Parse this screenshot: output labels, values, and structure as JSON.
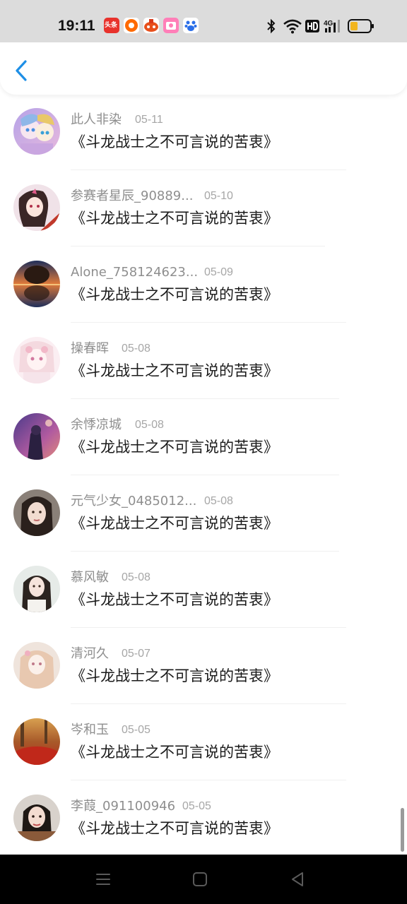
{
  "status_bar": {
    "time": "19:11",
    "notification_icons": [
      "toutiao-icon",
      "taobao-icon",
      "game-icon",
      "album-icon",
      "baidu-icon"
    ],
    "system_icons": [
      "bluetooth-icon",
      "wifi-icon",
      "hd-icon",
      "signal-4g-icon",
      "battery-icon"
    ],
    "toutiao_label": "头条"
  },
  "header": {
    "back_icon": "chevron-left-icon"
  },
  "list": {
    "items": [
      {
        "name": "此人非染",
        "date": "05-11",
        "title": "《斗龙战士之不可言说的苦衷》"
      },
      {
        "name": "参赛者星辰_90889...",
        "date": "05-10",
        "title": "《斗龙战士之不可言说的苦衷》"
      },
      {
        "name": "Alone_758124623...",
        "date": "05-09",
        "title": "《斗龙战士之不可言说的苦衷》"
      },
      {
        "name": "操春晖",
        "date": "05-08",
        "title": "《斗龙战士之不可言说的苦衷》"
      },
      {
        "name": "余悸凉城",
        "date": "05-08",
        "title": "《斗龙战士之不可言说的苦衷》"
      },
      {
        "name": "元气少女_0485012...",
        "date": "05-08",
        "title": "《斗龙战士之不可言说的苦衷》"
      },
      {
        "name": "慕风敏",
        "date": "05-08",
        "title": "《斗龙战士之不可言说的苦衷》"
      },
      {
        "name": "清河久",
        "date": "05-07",
        "title": "《斗龙战士之不可言说的苦衷》"
      },
      {
        "name": "岑和玉",
        "date": "05-05",
        "title": "《斗龙战士之不可言说的苦衷》"
      },
      {
        "name": "李葭_091100946",
        "date": "05-05",
        "title": "《斗龙战士之不可言说的苦衷》"
      }
    ]
  },
  "nav_bar": {
    "icons": [
      "menu-icon",
      "home-icon",
      "back-icon"
    ]
  },
  "colors": {
    "accent": "#1e8fe6",
    "name_text": "#8e8e8e",
    "date_text": "#a6a6a6",
    "title_text": "#1a1a1a",
    "status_bar_bg": "#dcdcdc",
    "nav_bar_bg": "#000000"
  }
}
